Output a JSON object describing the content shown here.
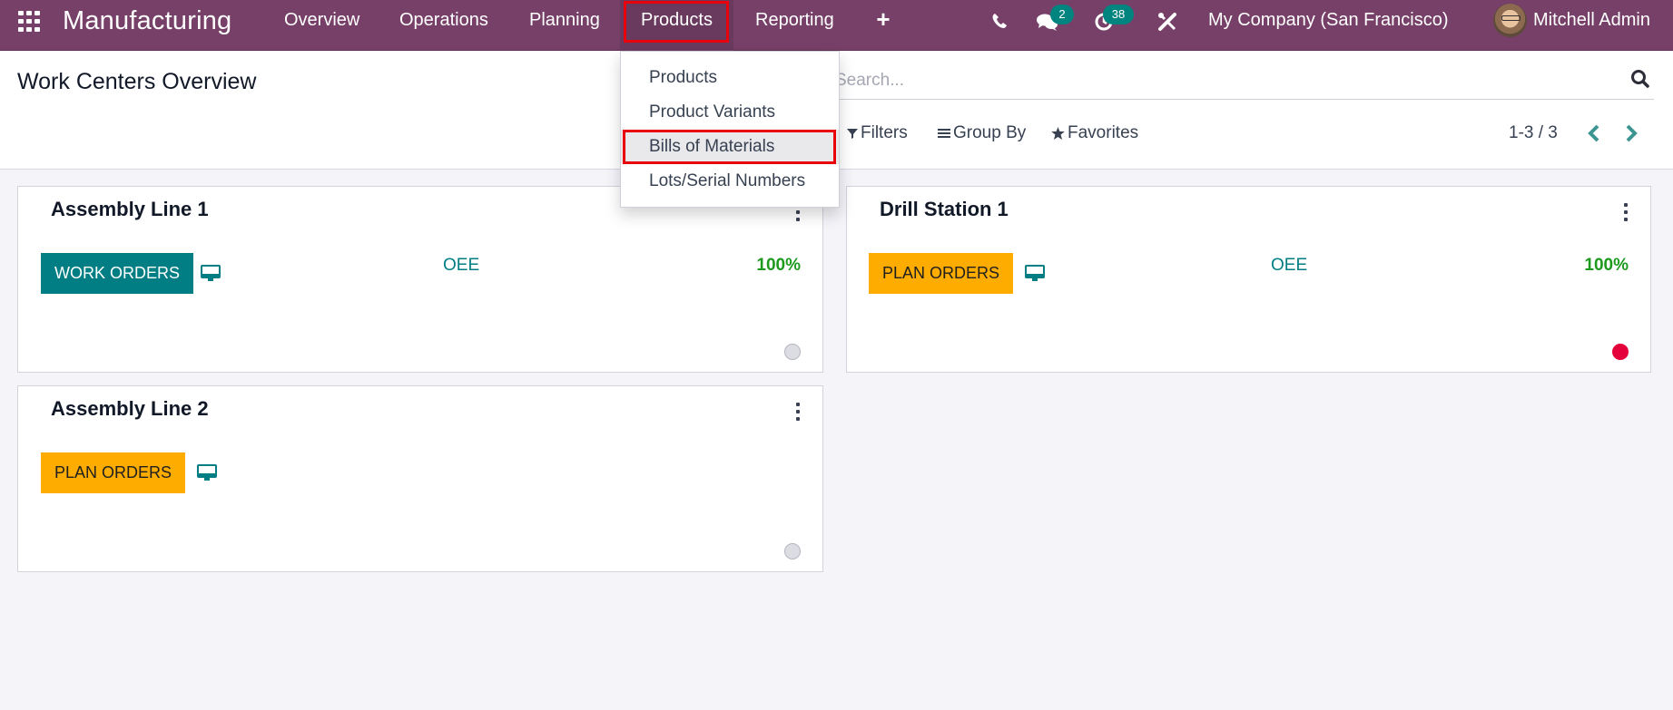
{
  "navbar": {
    "app_name": "Manufacturing",
    "menu": [
      {
        "label": "Overview"
      },
      {
        "label": "Operations"
      },
      {
        "label": "Planning"
      },
      {
        "label": "Products"
      },
      {
        "label": "Reporting"
      }
    ],
    "plus_label": "+",
    "icons": {
      "apps": "apps-grid-icon",
      "phone": "phone-icon",
      "messages": "chat-icon",
      "activities": "clock-icon",
      "debug": "tools-icon"
    },
    "messages_count": "2",
    "activities_count": "38",
    "company": "My Company (San Francisco)",
    "user_name": "Mitchell Admin",
    "brand_color": "#774068",
    "badge_color": "#00847f"
  },
  "products_dropdown": {
    "items": [
      {
        "label": "Products"
      },
      {
        "label": "Product Variants"
      },
      {
        "label": "Bills of Materials"
      },
      {
        "label": "Lots/Serial Numbers"
      }
    ],
    "highlighted": "Bills of Materials"
  },
  "control_panel": {
    "title": "Work Centers Overview",
    "search_placeholder": "Search...",
    "filters_label": "Filters",
    "group_by_label": "Group By",
    "favorites_label": "Favorites",
    "pager": "1-3 / 3"
  },
  "cards": [
    {
      "title": "Assembly Line 1",
      "button_label": "WORK ORDERS",
      "button_style": "primary",
      "oee_label": "OEE",
      "oee_value": "100%",
      "status": "grey"
    },
    {
      "title": "Drill Station 1",
      "button_label": "PLAN ORDERS",
      "button_style": "warning",
      "oee_label": "OEE",
      "oee_value": "100%",
      "status": "red"
    },
    {
      "title": "Assembly Line 2",
      "button_label": "PLAN ORDERS",
      "button_style": "warning",
      "status": "grey"
    }
  ],
  "colors": {
    "primary_button": "#017e84",
    "warning_button": "#ffac00",
    "oee_value": "#1d9a1d",
    "status_red": "#e4003a",
    "highlight_box": "#e8000b"
  }
}
